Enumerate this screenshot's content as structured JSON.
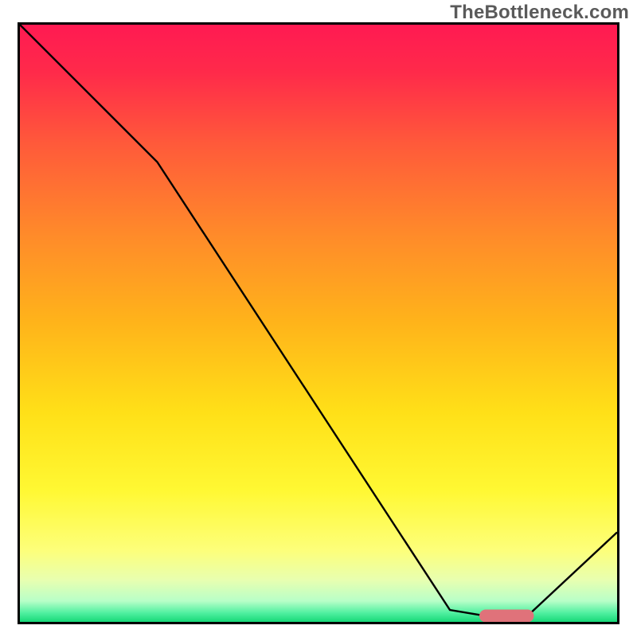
{
  "watermark": "TheBottleneck.com",
  "chart_data": {
    "type": "line",
    "title": "",
    "xlabel": "",
    "ylabel": "",
    "xlim": [
      0,
      100
    ],
    "ylim": [
      0,
      100
    ],
    "grid": false,
    "legend": false,
    "x": [
      0,
      23,
      72,
      78,
      85,
      100
    ],
    "values": [
      100,
      77,
      2,
      1,
      1,
      15
    ],
    "line_color": "#000000",
    "line_width": 2.4,
    "marker": {
      "x_start": 78,
      "x_end": 85,
      "y": 1,
      "color": "#e0727a",
      "thickness": 3.2
    },
    "background_gradient": {
      "stops": [
        {
          "offset": 0.0,
          "color": "#ff1a52"
        },
        {
          "offset": 0.08,
          "color": "#ff2a4a"
        },
        {
          "offset": 0.2,
          "color": "#ff5a3a"
        },
        {
          "offset": 0.35,
          "color": "#ff8a2a"
        },
        {
          "offset": 0.5,
          "color": "#ffb41a"
        },
        {
          "offset": 0.65,
          "color": "#ffe018"
        },
        {
          "offset": 0.78,
          "color": "#fff833"
        },
        {
          "offset": 0.88,
          "color": "#fdff7a"
        },
        {
          "offset": 0.93,
          "color": "#e8ffb0"
        },
        {
          "offset": 0.965,
          "color": "#b8ffc8"
        },
        {
          "offset": 0.985,
          "color": "#50f0a0"
        },
        {
          "offset": 1.0,
          "color": "#18d878"
        }
      ]
    }
  }
}
